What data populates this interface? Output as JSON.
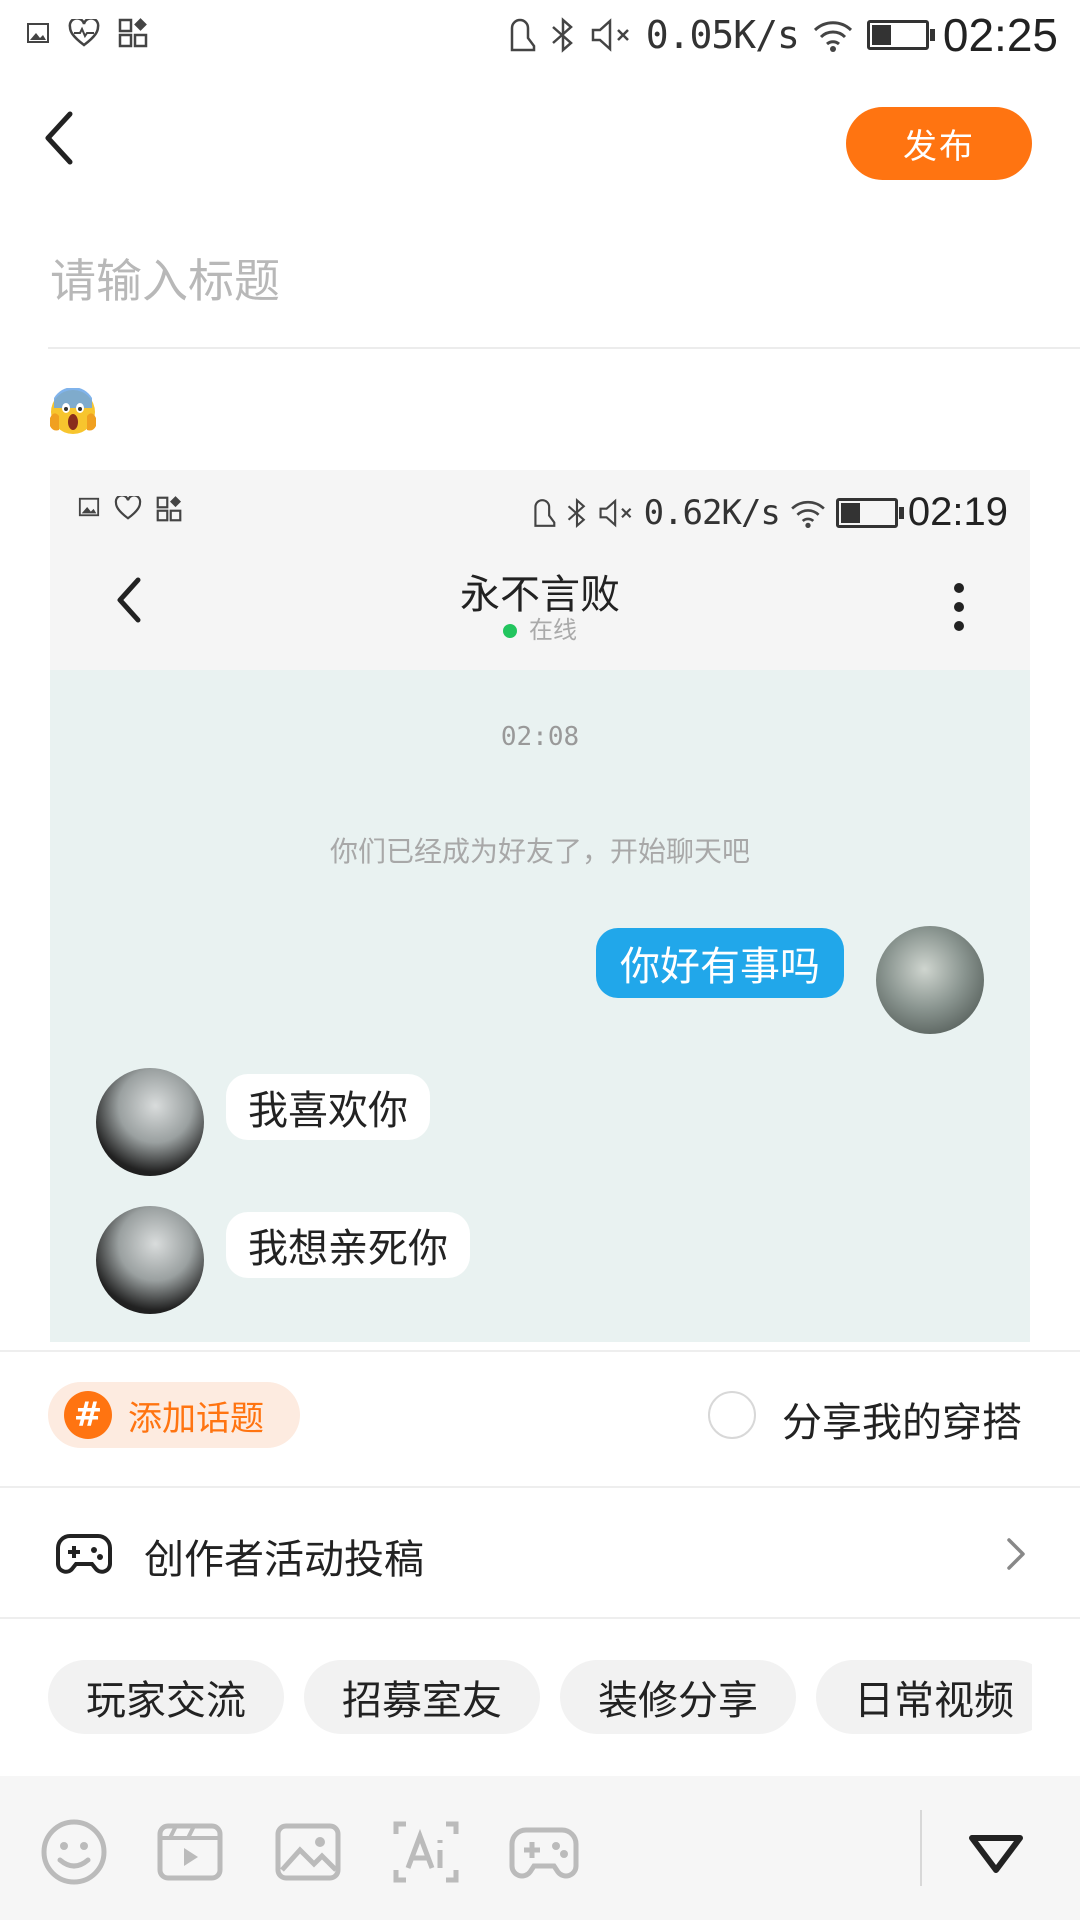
{
  "status_bar": {
    "network_speed": "0.05K/s",
    "time": "02:25",
    "battery_level": 0.35
  },
  "header": {
    "publish_label": "发布"
  },
  "title_field": {
    "placeholder": "请输入标题",
    "value": ""
  },
  "body": {
    "emoji": "😱"
  },
  "embedded_screenshot": {
    "status_bar": {
      "network_speed": "0.62K/s",
      "time": "02:19",
      "battery_level": 0.35
    },
    "chat_title": "永不言败",
    "online_status": "在线",
    "messages_time": "02:08",
    "system_message": "你们已经成为好友了，开始聊天吧",
    "messages": [
      {
        "side": "out",
        "text": "你好有事吗"
      },
      {
        "side": "in",
        "text": "我喜欢你"
      },
      {
        "side": "in",
        "text": "我想亲死你"
      }
    ]
  },
  "topic": {
    "add_topic_label": "添加话题",
    "hash_symbol": "#",
    "share_outfit_label": "分享我的穿搭",
    "share_outfit_checked": false
  },
  "creator": {
    "label": "创作者活动投稿"
  },
  "tags": [
    "玩家交流",
    "招募室友",
    "装修分享",
    "日常视频"
  ],
  "toolbar": {
    "icons": [
      "emoji-icon",
      "video-icon",
      "image-icon",
      "ai-text-icon",
      "gamepad-icon",
      "collapse-triangle-icon"
    ]
  },
  "colors": {
    "accent": "#ff7411",
    "bubble_out": "#21a7ea",
    "chat_bg": "#e9f2f1"
  }
}
